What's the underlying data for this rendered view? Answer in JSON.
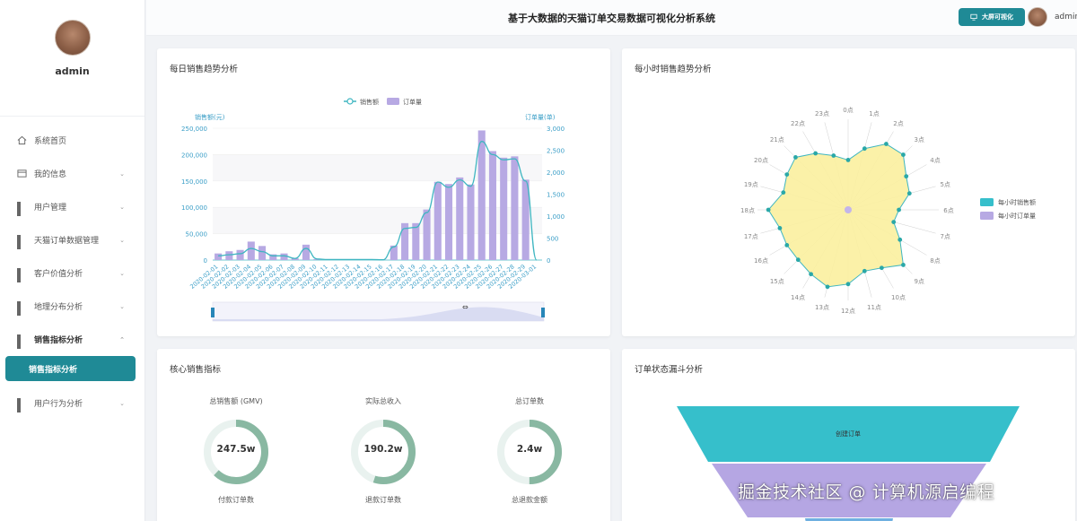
{
  "profile": {
    "name": "admin"
  },
  "header": {
    "title": "基于大数据的天猫订单交易数据可视化分析系统",
    "big_screen_label": "大屏可视化",
    "user_name": "admin"
  },
  "sidebar": {
    "items": [
      {
        "label": "系统首页",
        "icon": "home-icon"
      },
      {
        "label": "我的信息",
        "icon": "profile-card-icon"
      },
      {
        "label": "用户管理",
        "icon": "grid-icon"
      },
      {
        "label": "天猫订单数据管理",
        "icon": "grid-icon"
      },
      {
        "label": "客户价值分析",
        "icon": "grid-icon"
      },
      {
        "label": "地理分布分析",
        "icon": "grid-icon"
      },
      {
        "label": "销售指标分析",
        "icon": "grid-icon"
      },
      {
        "label": "用户行为分析",
        "icon": "grid-icon"
      }
    ],
    "active_sub": "销售指标分析"
  },
  "cards": {
    "daily_title": "每日销售趋势分析",
    "hourly_title": "每小时销售趋势分析",
    "kpi_title": "核心销售指标",
    "funnel_title": "订单状态漏斗分析"
  },
  "chart_data": [
    {
      "type": "bar",
      "legend": [
        "销售额",
        "订单量"
      ],
      "ylabel": "销售额(元)",
      "ylabel_right": "订单量(单)",
      "y_ticks": [
        "250,000",
        "200,000",
        "150,000",
        "100,000",
        "50,000",
        "0"
      ],
      "y2_ticks": [
        "3,000",
        "2,500",
        "2,000",
        "1,500",
        "1,000",
        "500",
        "0"
      ],
      "ylim": [
        0,
        250000
      ],
      "y2lim": [
        0,
        3000
      ],
      "categories": [
        "2020-02-01",
        "2020-02-02",
        "2020-02-03",
        "2020-02-04",
        "2020-02-05",
        "2020-02-06",
        "2020-02-07",
        "2020-02-08",
        "2020-02-09",
        "2020-02-10",
        "2020-02-11",
        "2020-02-12",
        "2020-02-13",
        "2020-02-14",
        "2020-02-15",
        "2020-02-16",
        "2020-02-17",
        "2020-02-18",
        "2020-02-19",
        "2020-02-20",
        "2020-02-21",
        "2020-02-22",
        "2020-02-23",
        "2020-02-24",
        "2020-02-25",
        "2020-02-26",
        "2020-02-27",
        "2020-02-28",
        "2020-02-29",
        "2020-03-01"
      ],
      "orders": [
        150,
        200,
        230,
        420,
        320,
        130,
        150,
        40,
        350,
        20,
        10,
        10,
        10,
        10,
        10,
        5,
        330,
        840,
        840,
        1150,
        1780,
        1730,
        1880,
        1720,
        2950,
        2480,
        2330,
        2360,
        1830,
        0
      ],
      "sales": [
        8000,
        10000,
        12000,
        22000,
        16000,
        8000,
        8000,
        3000,
        22000,
        2000,
        1000,
        1000,
        1000,
        1000,
        1000,
        500,
        25000,
        60000,
        62000,
        90000,
        148000,
        138000,
        152000,
        140000,
        225000,
        200000,
        190000,
        192000,
        150000,
        0
      ]
    },
    {
      "type": "radar",
      "legend": [
        "每小时销售额",
        "每小时订单量"
      ],
      "indicators": [
        "0点",
        "23点",
        "22点",
        "21点",
        "20点",
        "19点",
        "18点",
        "17点",
        "16点",
        "15点",
        "14点",
        "13点",
        "12点",
        "11点",
        "10点",
        "9点",
        "8点",
        "7点",
        "6点",
        "5点",
        "4点",
        "3点",
        "2点",
        "1点"
      ],
      "sales": [
        0.55,
        0.62,
        0.72,
        0.82,
        0.78,
        0.74,
        0.88,
        0.78,
        0.78,
        0.78,
        0.82,
        0.88,
        0.82,
        0.7,
        0.74,
        0.86,
        0.66,
        0.52,
        0.56,
        0.7,
        0.74,
        0.86,
        0.84,
        0.7
      ],
      "orders": [
        0.02,
        0.02,
        0.02,
        0.02,
        0.02,
        0.02,
        0.02,
        0.02,
        0.02,
        0.02,
        0.02,
        0.02,
        0.02,
        0.02,
        0.02,
        0.02,
        0.02,
        0.02,
        0.02,
        0.02,
        0.02,
        0.02,
        0.02,
        0.02
      ]
    }
  ],
  "kpis": [
    {
      "label": "总销售额 (GMV)",
      "value": "247.5w",
      "sub": "付款订单数",
      "progress": 0.62
    },
    {
      "label": "实际总收入",
      "value": "190.2w",
      "sub": "退款订单数",
      "progress": 0.55
    },
    {
      "label": "总订单数",
      "value": "2.4w",
      "sub": "总退款金额",
      "progress": 0.5
    }
  ],
  "funnel": {
    "top_label": "创建订单"
  },
  "watermark": "掘金技术社区 @ 计算机源启编程"
}
